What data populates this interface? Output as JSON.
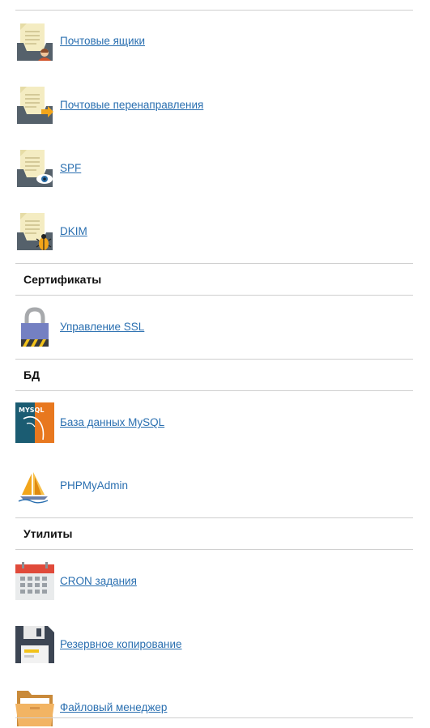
{
  "mail": {
    "items": [
      {
        "label": "Почтовые ящики",
        "icon": "mailbox-user-icon"
      },
      {
        "label": "Почтовые перенаправления",
        "icon": "mail-forward-icon"
      },
      {
        "label": "SPF",
        "icon": "mail-spf-eye-icon"
      },
      {
        "label": "DKIM",
        "icon": "mail-dkim-bug-icon"
      }
    ]
  },
  "certificates": {
    "title": "Сертификаты",
    "items": [
      {
        "label": "Управление SSL",
        "icon": "padlock-icon"
      }
    ]
  },
  "db": {
    "title": "БД",
    "items": [
      {
        "label": "База данных MySQL",
        "icon": "mysql-icon",
        "icon_text": "MYSQL"
      },
      {
        "label": "PHPMyAdmin",
        "icon": "phpmyadmin-sailboat-icon"
      }
    ]
  },
  "utilities": {
    "title": "Утилиты",
    "items": [
      {
        "label": "CRON задания",
        "icon": "calendar-icon"
      },
      {
        "label": "Резервное копирование",
        "icon": "floppy-disk-icon"
      },
      {
        "label": "Файловый менеджер",
        "icon": "folder-icon"
      }
    ]
  },
  "colors": {
    "link": "#2a6fb0",
    "divider": "#cfcfcf",
    "heading": "#111111"
  }
}
